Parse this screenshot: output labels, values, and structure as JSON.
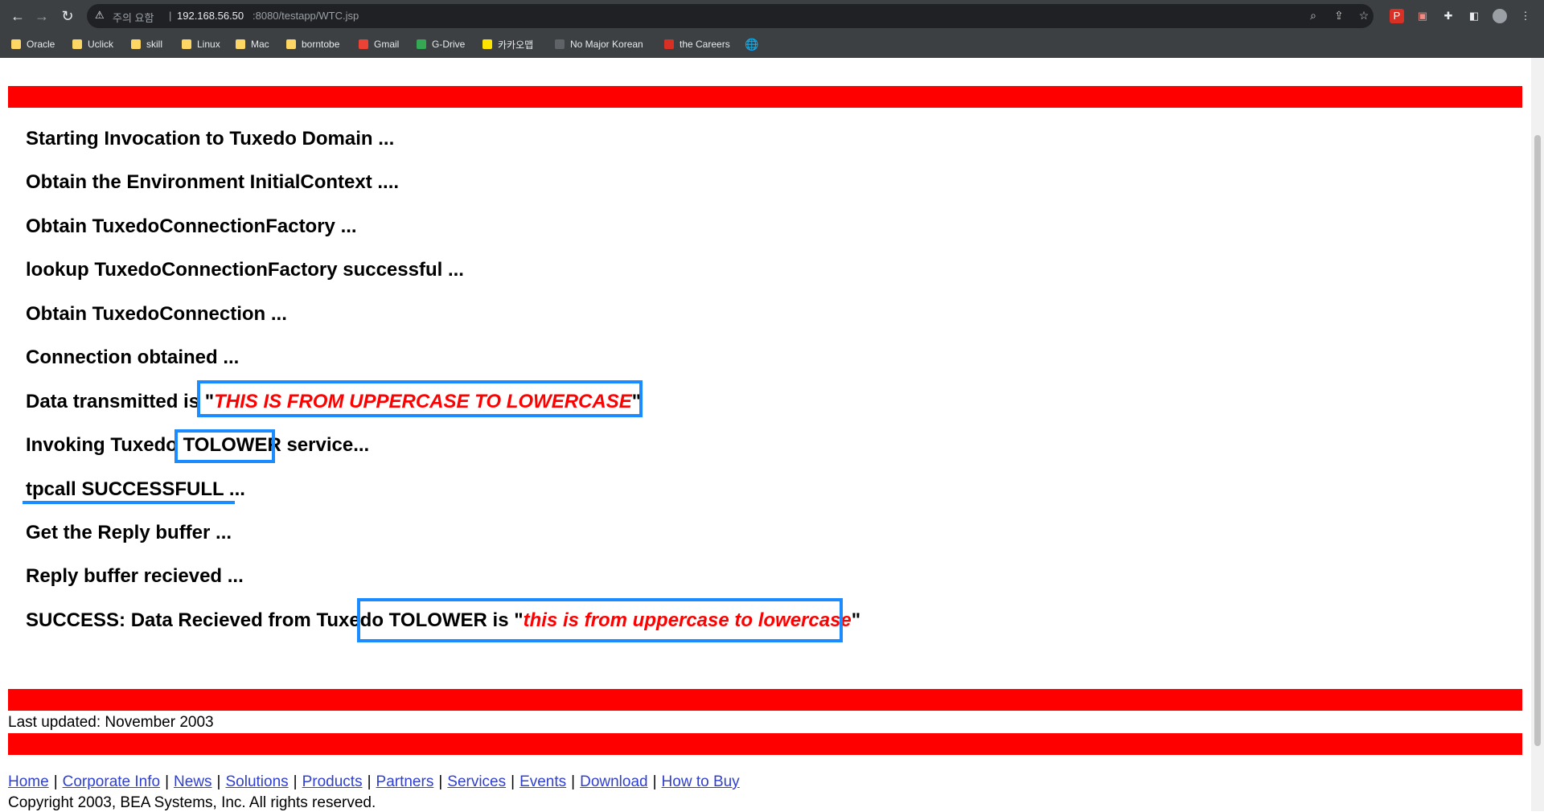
{
  "browser": {
    "warning_text": "주의 요함",
    "url_host": "192.168.56.50",
    "url_path": ":8080/testapp/WTC.jsp",
    "bookmarks": [
      {
        "label": "Oracle",
        "icon": "folder-icon"
      },
      {
        "label": "Uclick",
        "icon": "folder-icon"
      },
      {
        "label": "skill",
        "icon": "folder-icon"
      },
      {
        "label": "Linux",
        "icon": "folder-icon"
      },
      {
        "label": "Mac",
        "icon": "folder-icon"
      },
      {
        "label": "borntobe",
        "icon": "folder-icon"
      },
      {
        "label": "Gmail",
        "icon": "gmail-icon"
      },
      {
        "label": "G-Drive",
        "icon": "drive-icon"
      },
      {
        "label": "카카오맵",
        "icon": "map-icon"
      },
      {
        "label": "No Major Korean",
        "icon": "dots-icon"
      },
      {
        "label": "the Careers",
        "icon": "careers-icon"
      }
    ]
  },
  "page": {
    "lines": [
      "Starting Invocation to Tuxedo Domain ...",
      "Obtain the Environment InitialContext ....",
      "Obtain TuxedoConnectionFactory ...",
      "lookup TuxedoConnectionFactory successful ...",
      "Obtain TuxedoConnection ...",
      "Connection obtained ..."
    ],
    "data_transmitted_prefix": "Data transmitted is ",
    "quote_open": "\"",
    "data_transmitted_value": "THIS IS FROM UPPERCASE TO LOWERCASE",
    "quote_close": "\"",
    "invoking_prefix": "Invoking Tuxedo ",
    "invoking_service": "TOLOWER",
    "invoking_suffix": " service...",
    "tpcall": "tpcall SUCCESSFULL ...",
    "get_reply": "Get the Reply buffer ...",
    "reply_received": "Reply buffer recieved ...",
    "success_prefix": "SUCCESS: Data Recieved from Tuxedo ",
    "success_service": "TOLOWER is ",
    "success_value": "this is from uppercase to lowercase",
    "last_updated": "Last updated: November 2003",
    "footer_links": [
      "Home",
      "Corporate Info",
      "News",
      "Solutions",
      "Products",
      "Partners",
      "Services",
      "Events",
      "Download",
      "How to Buy"
    ],
    "copyright": "Copyright 2003, BEA Systems, Inc. All rights reserved."
  },
  "colors": {
    "banner": "#ff0000",
    "highlight": "#1a8cff",
    "link": "#2f3fcf"
  }
}
